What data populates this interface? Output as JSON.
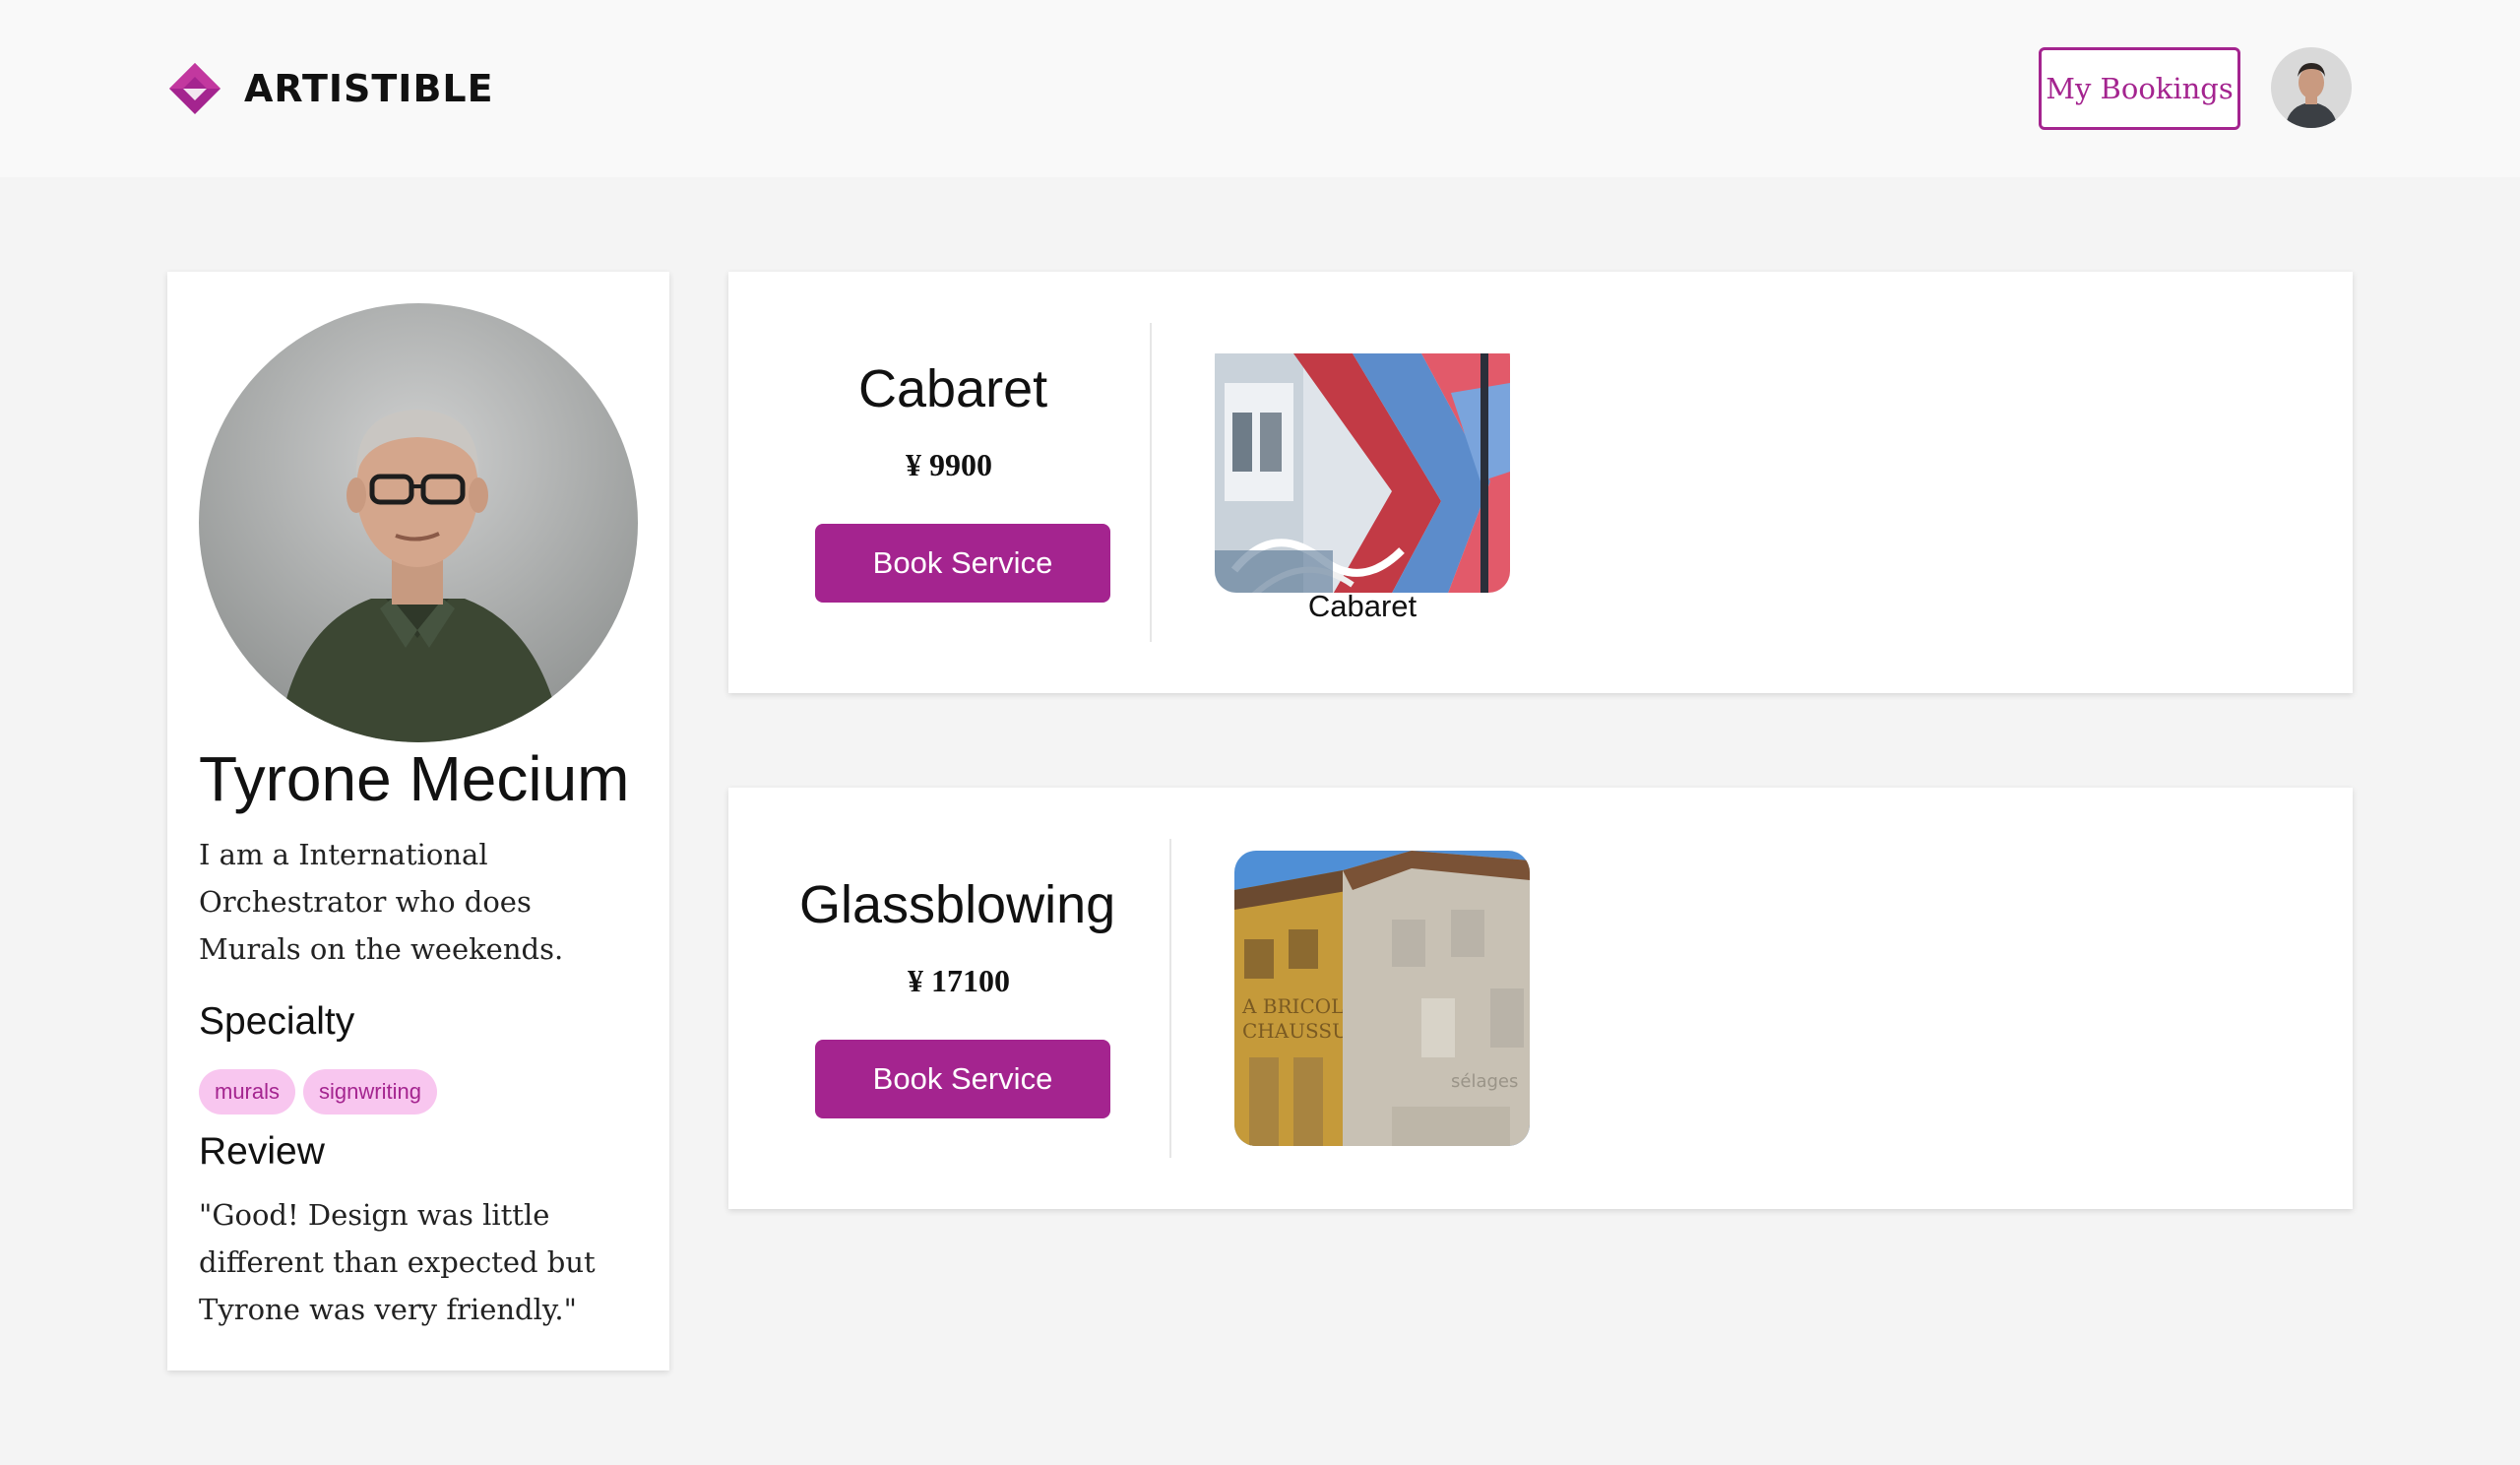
{
  "header": {
    "brand": "ARTISTIBLE",
    "bookings_label": "My Bookings",
    "accent_color": "#a4248f"
  },
  "profile": {
    "name": "Tyrone Mecium",
    "bio": "I am a International Orchestrator who does Murals on the weekends.",
    "specialty_heading": "Specialty",
    "specialties": [
      "murals",
      "signwriting"
    ],
    "review_heading": "Review",
    "review": "\"Good! Design was little different than expected but Tyrone was very friendly.\""
  },
  "services": [
    {
      "title": "Cabaret",
      "price": "¥ 9900",
      "button_label": "Book Service",
      "image_caption": "Cabaret"
    },
    {
      "title": "Glassblowing",
      "price": "¥ 17100",
      "button_label": "Book Service",
      "image_caption": ""
    }
  ],
  "colors": {
    "accent": "#a4248f",
    "tag_bg": "#f8c6ef",
    "page_bg": "#f4f4f4"
  }
}
